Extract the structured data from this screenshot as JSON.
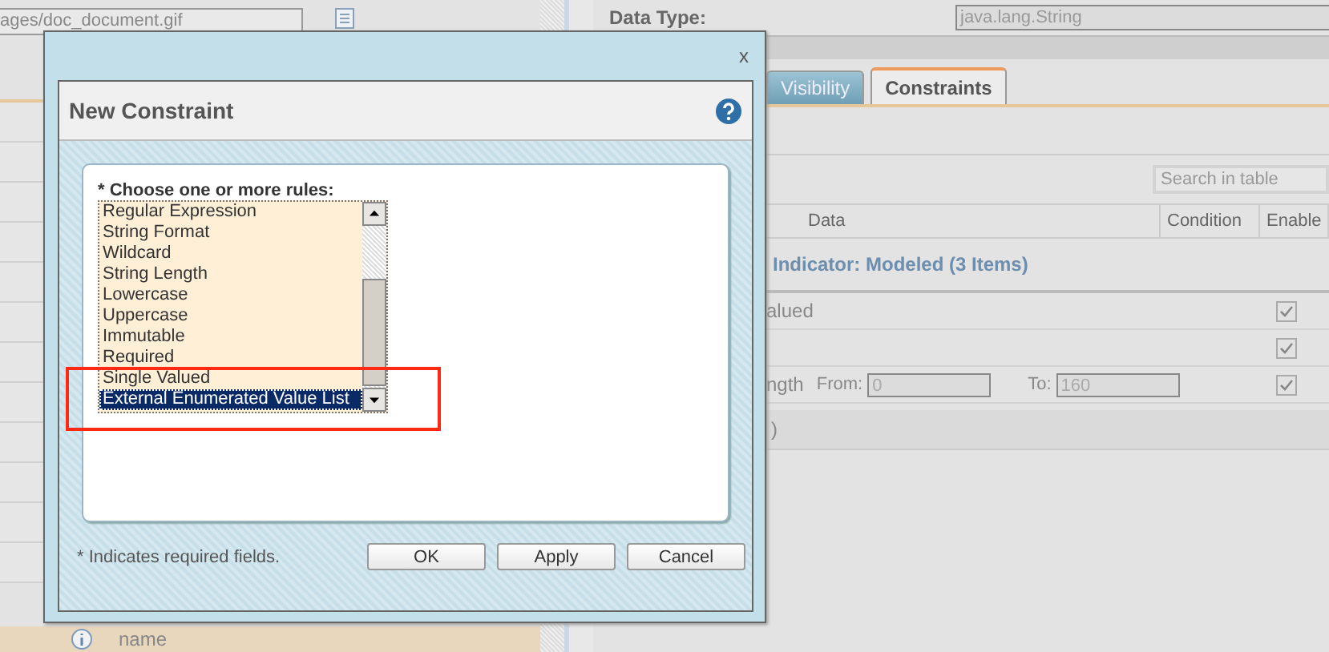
{
  "left_panel": {
    "path_field": "ages/doc_document.gif",
    "bottom_row": {
      "text": "name"
    }
  },
  "details": {
    "data_type_label": "Data Type:",
    "data_type_value": "java.lang.String",
    "tabs": [
      {
        "label": "Visibility",
        "selected": false
      },
      {
        "label": "Constraints",
        "selected": true
      }
    ],
    "search": {
      "placeholder": "Search in table"
    },
    "table": {
      "columns": [
        "Data",
        "Condition",
        "Enable"
      ],
      "group": "Indicator: Modeled (3 Items)",
      "rows": [
        {
          "kind": "plain",
          "text": "alued",
          "checked": true
        },
        {
          "kind": "plain",
          "checked": true
        },
        {
          "kind": "range",
          "text": "ngth",
          "from_label": "From:",
          "from_value": "0",
          "to_label": "To:",
          "to_value": "160",
          "checked": true
        }
      ],
      "footer_row": ")"
    }
  },
  "dialog": {
    "close": "x",
    "title": "New Constraint",
    "rules_label": "* Choose one or more rules:",
    "rules": [
      {
        "label": "Regular Expression",
        "selected": false
      },
      {
        "label": "String Format",
        "selected": false
      },
      {
        "label": "Wildcard",
        "selected": false
      },
      {
        "label": "String Length",
        "selected": false
      },
      {
        "label": "Lowercase",
        "selected": false
      },
      {
        "label": "Uppercase",
        "selected": false
      },
      {
        "label": "Immutable",
        "selected": false
      },
      {
        "label": "Required",
        "selected": false
      },
      {
        "label": "Single Valued",
        "selected": false
      },
      {
        "label": "External Enumerated Value List",
        "selected": true
      }
    ],
    "note": "* Indicates required fields.",
    "buttons": [
      "OK",
      "Apply",
      "Cancel"
    ]
  }
}
